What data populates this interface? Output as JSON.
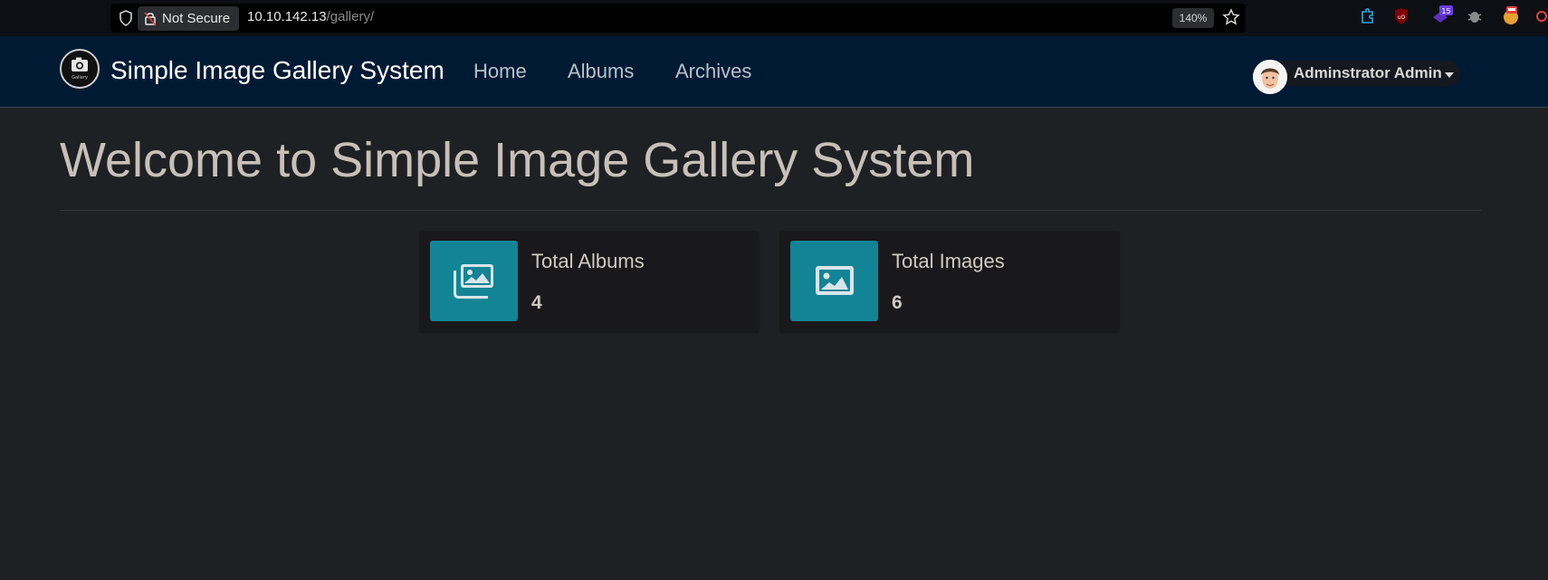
{
  "browser": {
    "security_label": "Not Secure",
    "url_host": "10.10.142.13",
    "url_path": "/gallery/",
    "zoom": "140%",
    "extension_badge": "15"
  },
  "navbar": {
    "brand": "Simple Image Gallery System",
    "logo_text": "Gallery",
    "links": [
      "Home",
      "Albums",
      "Archives"
    ],
    "user_name": "Adminstrator Admin"
  },
  "main": {
    "title": "Welcome to Simple Image Gallery System",
    "cards": [
      {
        "label": "Total Albums",
        "value": "4",
        "icon": "images-icon"
      },
      {
        "label": "Total Images",
        "value": "6",
        "icon": "image-icon"
      }
    ]
  },
  "colors": {
    "navbar_bg": "#001a33",
    "page_bg": "#1f2023",
    "card_bg": "#19191b",
    "icon_box": "#138496"
  }
}
